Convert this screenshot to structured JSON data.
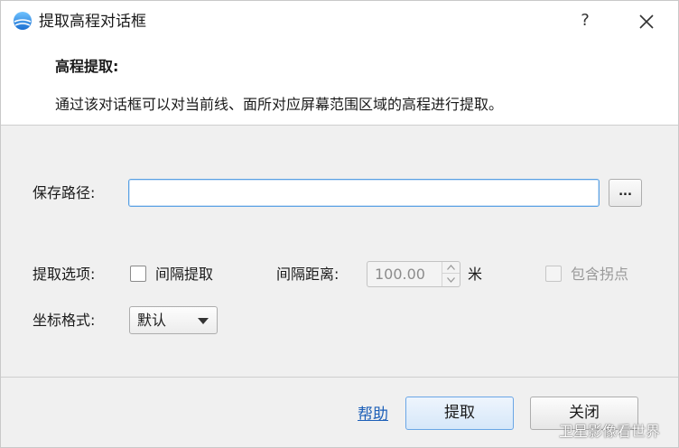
{
  "window": {
    "title": "提取高程对话框",
    "help_glyph": "?"
  },
  "header": {
    "title": "高程提取:",
    "description": "通过该对话框可以对当前线、面所对应屏幕范围区域的高程进行提取。"
  },
  "form": {
    "save_path": {
      "label": "保存路径:",
      "value": "",
      "browse_label": "..."
    },
    "extract_options": {
      "label": "提取选项:",
      "interval_checkbox_label": "间隔提取",
      "interval_checked": false,
      "interval_distance_label": "间隔距离:",
      "interval_distance_value": "100.00",
      "unit": "米",
      "include_turn_points_label": "包含拐点",
      "include_turn_points_checked": false
    },
    "coordinate_format": {
      "label": "坐标格式:",
      "selected": "默认"
    }
  },
  "footer": {
    "help_link": "帮助",
    "extract_button": "提取",
    "close_button": "关闭"
  },
  "watermark": "卫星影像看世界",
  "colors": {
    "link": "#1c5fb8",
    "focus_border": "#5aa1e3",
    "panel": "#f0f0f0"
  }
}
